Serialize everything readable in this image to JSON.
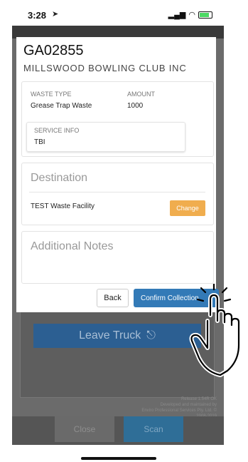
{
  "status_bar": {
    "time": "3:28",
    "signal": "..ıl",
    "wifi": "wifi"
  },
  "background": {
    "leave_truck_label": "Leave Truck",
    "footer_lines": [
      "Release 1.54R OK",
      "Developed and maintained by",
      "Enviro Professional Services Pty. Ltd. ©",
      "2008-2019"
    ],
    "close_label": "Close",
    "scan_label": "Scan"
  },
  "modal": {
    "job_id": "GA02855",
    "client_name": "MILLSWOOD BOWLING CLUB INC",
    "waste": {
      "type_label": "WASTE TYPE",
      "type_value": "Grease Trap Waste",
      "amount_label": "AMOUNT",
      "amount_value": "1000",
      "service_label": "SERVICE INFO",
      "service_value": "TBI"
    },
    "destination": {
      "title": "Destination",
      "facility": "TEST Waste Facility",
      "change_label": "Change"
    },
    "notes": {
      "title": "Additional Notes"
    },
    "buttons": {
      "back_label": "Back",
      "confirm_label": "Confirm Collection"
    }
  },
  "colors": {
    "primary": "#337ab7",
    "warning": "#f0ad4e",
    "overlay": "#6b6b6b"
  }
}
